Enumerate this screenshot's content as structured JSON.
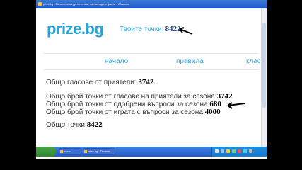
{
  "window": {
    "title": "prize.bg - Печелене за да печелиш, за награди и факти - Windows"
  },
  "header": {
    "logo_text": "prize.bg",
    "points_label": "Твоите точки:",
    "points_value": "8422"
  },
  "nav": {
    "items": [
      {
        "label": "начало"
      },
      {
        "label": "правила"
      },
      {
        "label": "класиране"
      }
    ]
  },
  "stats": [
    {
      "label": "Общо гласове от приятели:",
      "value": "3742"
    },
    {
      "label": "Общо брой точки от гласове на приятели за сезона:",
      "value": "3742"
    },
    {
      "label": "Общо брой точки от одобрени въпроси за сезона:",
      "value": "680"
    },
    {
      "label": "Общо брой точки от играта с въпроси за сезона:",
      "value": "4000"
    },
    {
      "label": "Общо точки:",
      "value": "8422"
    }
  ],
  "taskbar": {
    "tasks": [
      {
        "label": "Inbox"
      },
      {
        "label": "prize.bg - Печеле..."
      }
    ]
  },
  "colors": {
    "accent": "#2aa2d8",
    "nav_link": "#35a6d9",
    "taskbar": "#2458c6"
  }
}
